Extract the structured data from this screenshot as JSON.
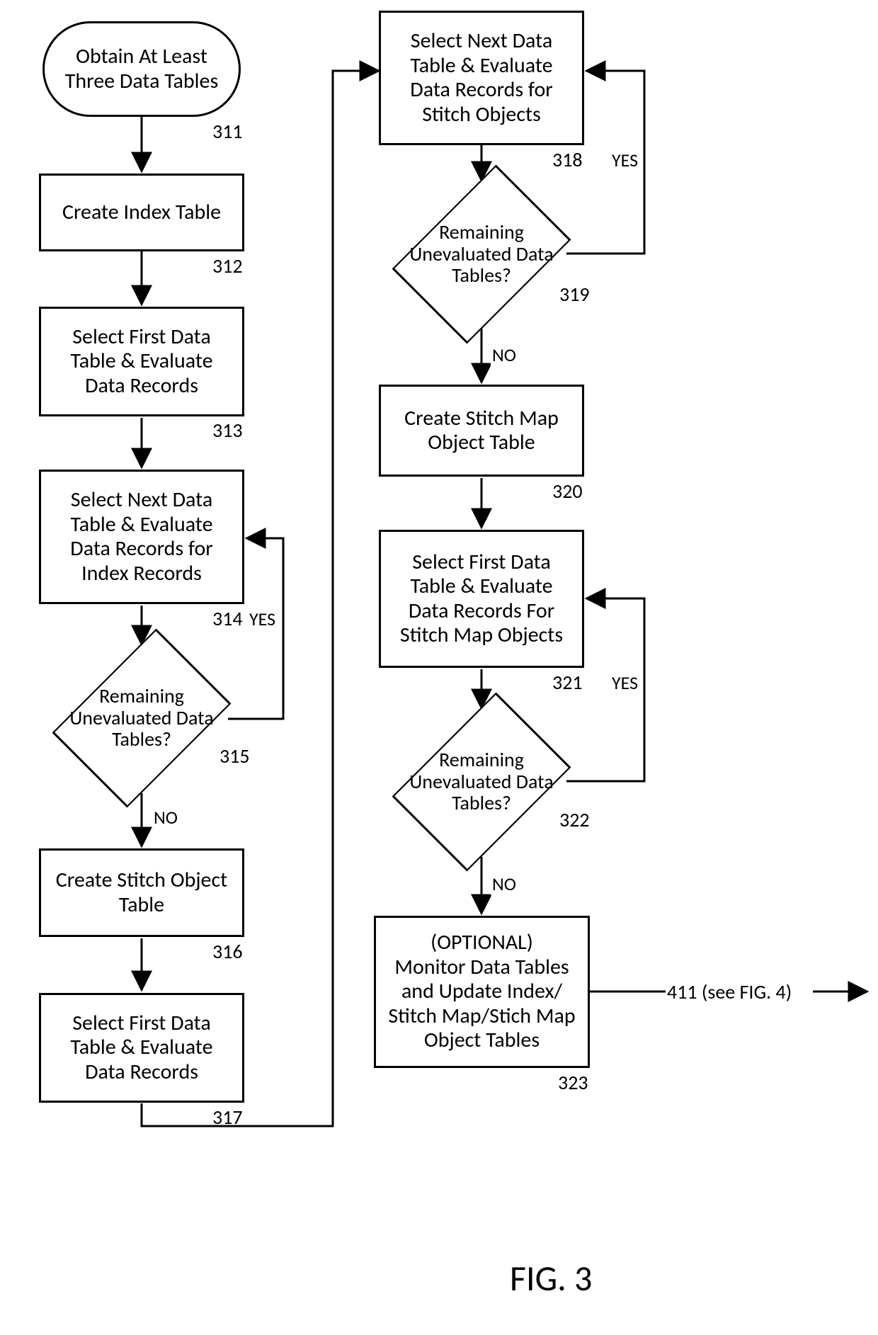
{
  "nodes": {
    "n311": {
      "text": "Obtain At Least Three Data Tables",
      "ref": "311"
    },
    "n312": {
      "text": "Create Index Table",
      "ref": "312"
    },
    "n313": {
      "text": "Select First Data Table & Evaluate Data Records",
      "ref": "313"
    },
    "n314": {
      "text": "Select Next Data Table & Evaluate Data Records for Index Records",
      "ref": "314"
    },
    "n315": {
      "text": "Remaining Unevaluated Data Tables?",
      "ref": "315"
    },
    "n316": {
      "text": "Create Stitch Object Table",
      "ref": "316"
    },
    "n317": {
      "text": "Select First Data Table & Evaluate Data Records",
      "ref": "317"
    },
    "n318": {
      "text": "Select Next Data Table & Evaluate Data Records for Stitch Objects",
      "ref": "318"
    },
    "n319": {
      "text": "Remaining Unevaluated Data Tables?",
      "ref": "319"
    },
    "n320": {
      "text": "Create Stitch Map Object Table",
      "ref": "320"
    },
    "n321": {
      "text": "Select First Data Table & Evaluate Data Records For Stitch Map Objects",
      "ref": "321"
    },
    "n322": {
      "text": "Remaining Unevaluated Data Tables?",
      "ref": "322"
    },
    "n323": {
      "text": "(OPTIONAL)\nMonitor Data Tables and Update Index/ Stitch Map/Stich Map Object Tables",
      "ref": "323"
    }
  },
  "labels": {
    "yes": "YES",
    "no": "NO",
    "out": "411 (see FIG. 4)"
  },
  "figure": "FIG. 3"
}
